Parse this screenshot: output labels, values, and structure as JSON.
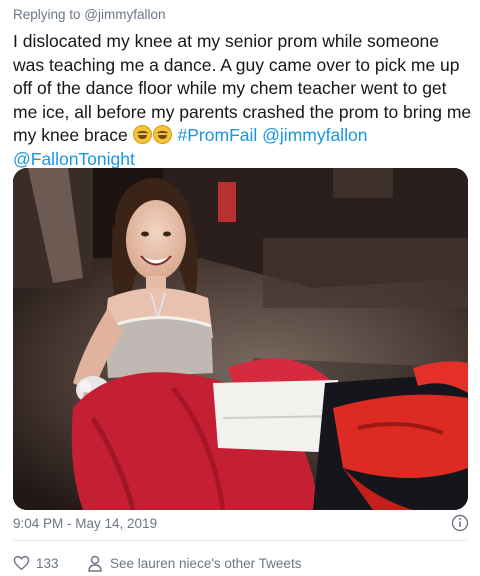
{
  "reply_to": "Replying to @jimmyfallon",
  "tweet": {
    "text_main": "I dislocated my knee at my senior prom while someone was teaching me a dance. A guy came over to pick me up off of the dance floor while my chem teacher went to get me ice, all before my parents crashed the prom to bring me my knee brace",
    "emojis": [
      "grinning-sweat-face-icon",
      "grinning-sweat-face-icon"
    ],
    "hashtag": "#PromFail",
    "mention_1": "@jimmyfallon",
    "mention_2": "@FallonTonight"
  },
  "timestamp": "9:04 PM - May 14, 2019",
  "likes": {
    "count": "133",
    "icon": "heart-icon"
  },
  "other_tweets": {
    "label": "See lauren niece's other Tweets",
    "icon": "person-icon"
  },
  "colors": {
    "link": "#1b95e0",
    "secondary_text": "#6b7785",
    "primary_text": "#14171a",
    "dress": "#c51f33"
  }
}
